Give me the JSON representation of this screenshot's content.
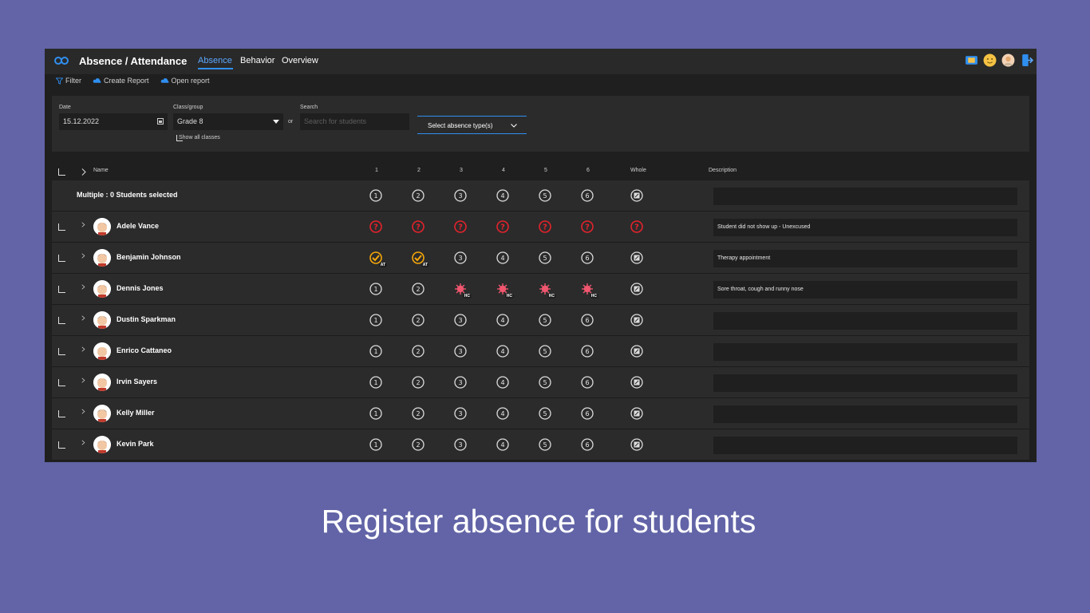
{
  "app": {
    "title": "Absence / Attendance",
    "tabs": [
      {
        "label": "Absence",
        "active": true
      },
      {
        "label": "Behavior",
        "active": false
      },
      {
        "label": "Overview",
        "active": false
      }
    ],
    "top_icons": [
      "whiteboard-icon",
      "emoji-icon",
      "user-avatar-icon",
      "exit-icon"
    ]
  },
  "commands": {
    "filter": "Filter",
    "create_report": "Create Report",
    "open_report": "Open report"
  },
  "filters": {
    "date_label": "Date",
    "date_value": "15.12.2022",
    "class_label": "Class/group",
    "class_value": "Grade 8",
    "or_text": "or",
    "search_label": "Search",
    "search_placeholder": "Search for students",
    "absence_type": "Select absence type(s)",
    "show_all_classes": "Show all classes"
  },
  "grid": {
    "headers": {
      "name": "Name",
      "periods": [
        "1",
        "2",
        "3",
        "4",
        "5",
        "6"
      ],
      "whole": "Whole",
      "description": "Description"
    },
    "multi_row": "Multiple : 0 Students selected",
    "rows": [
      {
        "name": "Adele Vance",
        "status": [
          "unexcused",
          "unexcused",
          "unexcused",
          "unexcused",
          "unexcused",
          "unexcused",
          "unexcused"
        ],
        "badge": "",
        "description": "Student did not show up - Unexcused"
      },
      {
        "name": "Benjamin Johnson",
        "status": [
          "attended",
          "attended",
          "none",
          "none",
          "none",
          "none",
          "none"
        ],
        "badge": "AT",
        "description": "Therapy appointment"
      },
      {
        "name": "Dennis Jones",
        "status": [
          "none",
          "none",
          "ill",
          "ill",
          "ill",
          "ill",
          "none"
        ],
        "badge": "HC",
        "description": "Sore throat, cough and runny nose"
      },
      {
        "name": "Dustin Sparkman",
        "status": [
          "none",
          "none",
          "none",
          "none",
          "none",
          "none",
          "none"
        ],
        "badge": "",
        "description": ""
      },
      {
        "name": "Enrico Cattaneo",
        "status": [
          "none",
          "none",
          "none",
          "none",
          "none",
          "none",
          "none"
        ],
        "badge": "",
        "description": ""
      },
      {
        "name": "Irvin Sayers",
        "status": [
          "none",
          "none",
          "none",
          "none",
          "none",
          "none",
          "none"
        ],
        "badge": "",
        "description": ""
      },
      {
        "name": "Kelly Miller",
        "status": [
          "none",
          "none",
          "none",
          "none",
          "none",
          "none",
          "none"
        ],
        "badge": "",
        "description": ""
      },
      {
        "name": "Kevin Park",
        "status": [
          "none",
          "none",
          "none",
          "none",
          "none",
          "none",
          "none"
        ],
        "badge": "",
        "description": ""
      }
    ]
  },
  "colors": {
    "accent": "#2f8ff0",
    "unexcused": "#e3232c",
    "attended": "#f5a70a",
    "ill": "#f0566e",
    "background": "#6264a7"
  },
  "caption": "Register absence for students"
}
